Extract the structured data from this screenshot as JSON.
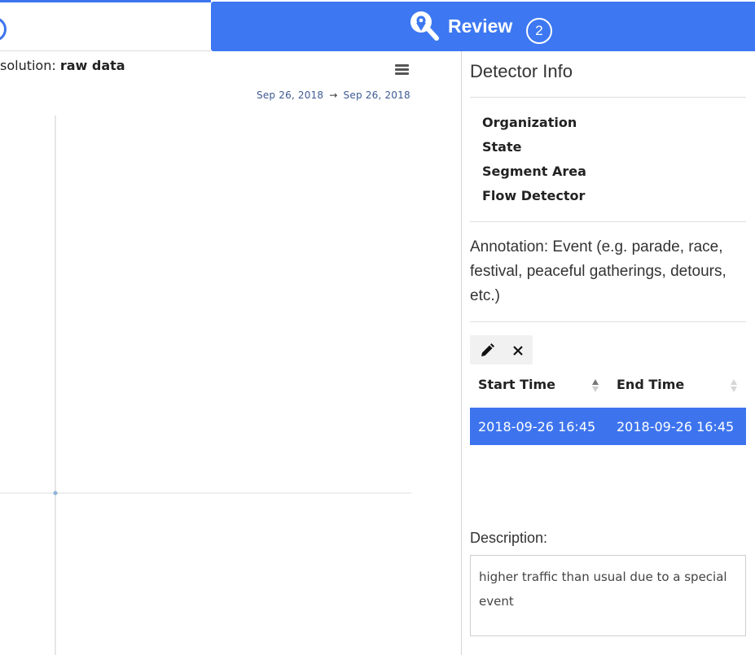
{
  "steps": {
    "review_label": "Review",
    "review_number": "2"
  },
  "chart_panel": {
    "resolution_prefix": "solution: ",
    "resolution_value": "raw data",
    "range_start": "Sep 26, 2018",
    "range_arrow": "→",
    "range_end": "Sep 26, 2018"
  },
  "chart_data": {
    "type": "line",
    "title": "",
    "xlabel": "",
    "ylabel": "",
    "series": [
      {
        "points": [
          [
            "2018-09-26",
            null
          ]
        ]
      }
    ]
  },
  "detector_info": {
    "title": "Detector Info",
    "fields": [
      "Organization",
      "State",
      "Segment Area",
      "Flow Detector"
    ]
  },
  "annotation": {
    "text": "Annotation: Event (e.g. parade, race, festival, peaceful gatherings, detours, etc.)"
  },
  "table": {
    "toolbar": {
      "edit_icon": "pencil-icon",
      "delete_icon": "close-icon"
    },
    "columns": [
      "Start Time",
      "End Time"
    ],
    "rows": [
      {
        "start": "2018-09-26 16:45",
        "end": "2018-09-26 16:45"
      }
    ]
  },
  "description": {
    "label": "Description:",
    "value": "higher traffic than usual due to a special event"
  },
  "colors": {
    "accent": "#3d74ee",
    "step_active": "#3d78f2"
  }
}
